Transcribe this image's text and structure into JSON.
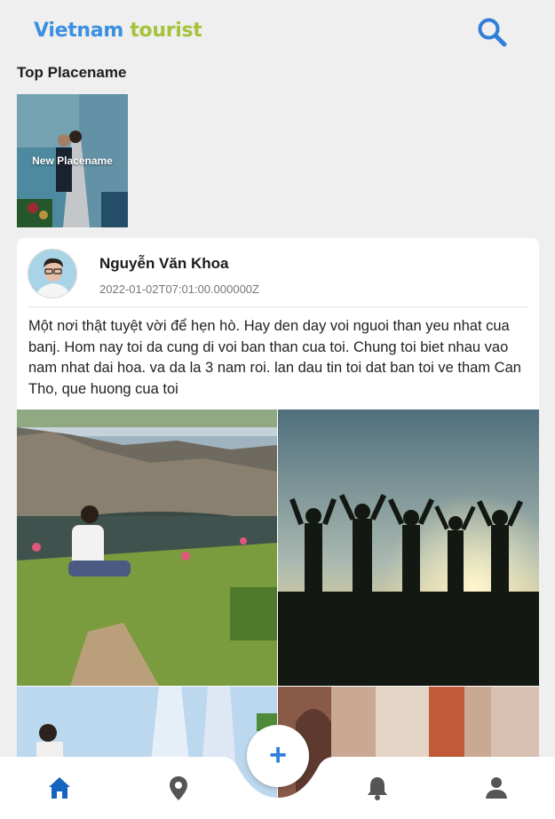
{
  "header": {
    "logo_word1": "Vietnam",
    "logo_word2": "tourist",
    "search_icon": "search-icon"
  },
  "top_places": {
    "title": "Top Placename",
    "items": [
      {
        "label": "New Placename"
      }
    ]
  },
  "post": {
    "author": "Nguyễn Văn Khoa",
    "timestamp": "2022-01-02T07:01:00.000000Z",
    "text": "Một nơi thật tuyệt vời để hẹn hò. Hay den day voi nguoi than yeu nhat cua banj. Hom nay toi da cung di voi ban than cua toi. Chung toi biet nhau vao nam nhat dai hoa. va da la 3 nam roi. lan dau tin toi dat ban toi ve tham Can Tho, que huong cua toi",
    "photos": [
      "lake-photo",
      "silhouette-photo",
      "wedding-photo",
      "building-photo"
    ]
  },
  "bottom_nav": {
    "items": [
      {
        "icon": "home-icon",
        "active": true
      },
      {
        "icon": "location-pin-icon",
        "active": false
      },
      {
        "icon": "bell-icon",
        "active": false
      },
      {
        "icon": "user-icon",
        "active": false
      }
    ],
    "fab_label": "+",
    "colors": {
      "active": "#1565c0",
      "inactive": "#555555",
      "fab": "#2f7fd8"
    }
  }
}
